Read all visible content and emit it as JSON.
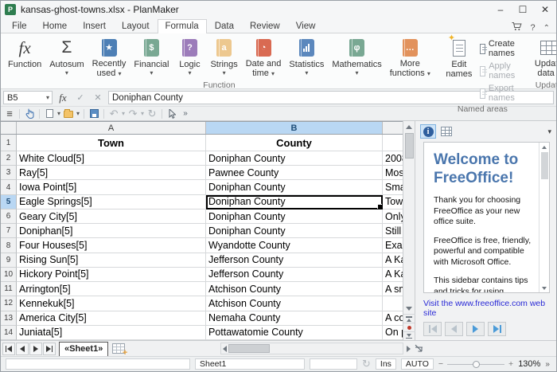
{
  "window": {
    "title": "kansas-ghost-towns.xlsx - PlanMaker"
  },
  "icons": {
    "dropdown": "▾",
    "overflow": "»",
    "hamburger": "≡",
    "sigma": "Σ",
    "fx": "fx",
    "check": "✓",
    "cross": "✕",
    "undo": "↶",
    "redo": "↷",
    "repeat": "↻",
    "minimize": "–",
    "maximize": "☐",
    "close": "✕",
    "help": "?",
    "collapse": "⌃",
    "star": "★",
    "question": "?",
    "dollar": "$",
    "a": "a",
    "phi": "φ",
    "ellipsis": "…",
    "clock": "◔",
    "excl": "!",
    "info": "i",
    "edit_star": "✦"
  },
  "menu": {
    "items": [
      "File",
      "Home",
      "Insert",
      "Layout",
      "Formula",
      "Data",
      "Review",
      "View"
    ],
    "active": "Formula"
  },
  "ribbon": {
    "function_label": "Function",
    "autosum_label": "Autosum",
    "recently_1": "Recently",
    "recently_2": "used",
    "financial_label": "Financial",
    "logic_label": "Logic",
    "strings_label": "Strings",
    "date_1": "Date and",
    "date_2": "time",
    "statistics_label": "Statistics",
    "mathematics_label": "Mathematics",
    "more_1": "More",
    "more_2": "functions",
    "group_function": "Function",
    "edit_1": "Edit",
    "edit_2": "names",
    "create_names": "Create names",
    "apply_names": "Apply names",
    "export_names": "Export names",
    "group_named": "Named areas",
    "update_1": "Update",
    "update_2": "data",
    "group_update": "Update",
    "icon_colors": {
      "recently": "#4d7fb5",
      "financial": "#79a893",
      "logic": "#9c7cba",
      "strings": "#edc88f",
      "date": "#d96a52",
      "statistics": "#5c88bd",
      "mathematics": "#79a893",
      "more": "#e2925c"
    }
  },
  "formula_bar": {
    "cell_ref": "B5",
    "formula": "Doniphan County"
  },
  "sheet": {
    "col_a": "A",
    "col_b": "B",
    "header_row": {
      "n": "1",
      "a": "Town",
      "b": "County"
    },
    "selected_cell": "B5",
    "rows": [
      {
        "n": "2",
        "a": "White Cloud[5]",
        "b": "Doniphan County",
        "c": "2008"
      },
      {
        "n": "3",
        "a": "Ray[5]",
        "b": "Pawnee County",
        "c": "Most"
      },
      {
        "n": "4",
        "a": "Iowa Point[5]",
        "b": "Doniphan County",
        "c": "Small"
      },
      {
        "n": "5",
        "a": "Eagle Springs[5]",
        "b": "Doniphan County",
        "c": "Town"
      },
      {
        "n": "6",
        "a": "Geary City[5]",
        "b": "Doniphan County",
        "c": "Only"
      },
      {
        "n": "7",
        "a": "Doniphan[5]",
        "b": "Doniphan County",
        "c": "Still c"
      },
      {
        "n": "8",
        "a": "Four Houses[5]",
        "b": "Wyandotte County",
        "c": "Exact"
      },
      {
        "n": "9",
        "a": "Rising Sun[5]",
        "b": "Jefferson County",
        "c": "A Kar"
      },
      {
        "n": "10",
        "a": "Hickory Point[5]",
        "b": "Jefferson County",
        "c": "A Kar"
      },
      {
        "n": "11",
        "a": "Arrington[5]",
        "b": "Atchison County",
        "c": "A sm"
      },
      {
        "n": "12",
        "a": "Kennekuk[5]",
        "b": "Atchison County",
        "c": ""
      },
      {
        "n": "13",
        "a": "America City[5]",
        "b": "Nemaha County",
        "c": "A cou"
      },
      {
        "n": "14",
        "a": "Juniata[5]",
        "b": "Pottawatomie County",
        "c": "On p"
      }
    ]
  },
  "sidebar": {
    "heading": "Welcome to FreeOffice!",
    "p1": "Thank you for choosing FreeOffice as your new office suite.",
    "p2": "FreeOffice is free, friendly, powerful and compatible with Microsoft Office.",
    "p3": "This sidebar contains tips and tricks for using FreeOffice. It also shows the differences to SoftMaker Office, the commercial office suite from SoftMaker.",
    "link": "Visit the www.freeoffice.com web site"
  },
  "tab_bar": {
    "sheet_tab": "«Sheet1»"
  },
  "status_bar": {
    "sheet_name": "Sheet1",
    "insert_mode": "Ins",
    "auto": "AUTO",
    "zoom_level": "130%"
  }
}
